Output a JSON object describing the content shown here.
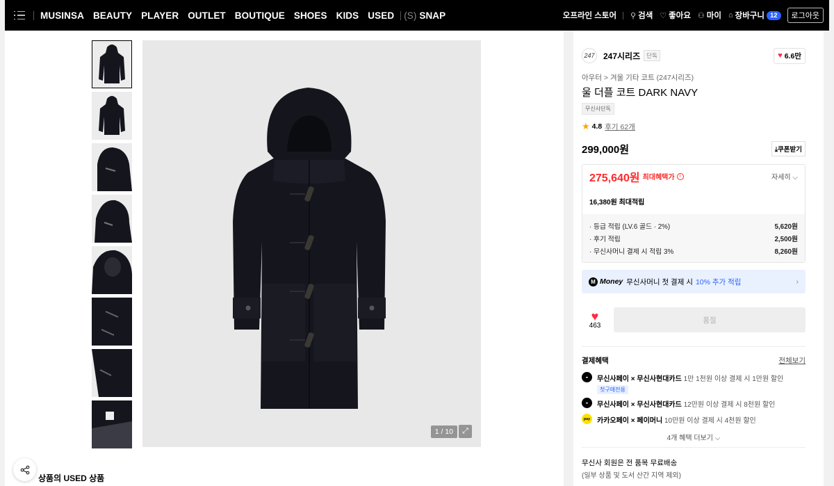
{
  "nav": {
    "items": [
      "MUSINSA",
      "BEAUTY",
      "PLAYER",
      "OUTLET",
      "BOUTIQUE",
      "SHOES",
      "KIDS",
      "USED"
    ],
    "snap_prefix": "(S)",
    "snap_label": "SNAP",
    "right": {
      "offline_store": "오프라인 스토어",
      "search": "검색",
      "like": "좋아요",
      "my": "마이",
      "cart": "장바구니",
      "cart_count": "12",
      "logout": "로그아웃"
    }
  },
  "gallery": {
    "counter": "1 / 10",
    "thumb_count": 8
  },
  "brand": {
    "logo_text": "247",
    "name": "247시리즈",
    "tag": "단독",
    "likes": "6.6만"
  },
  "product": {
    "breadcrumb": "아우터 > 겨울 기타 코트 (247시리즈)",
    "title": "울 더플 코트 DARK NAVY",
    "exclusive_tag": "무신사단독",
    "rating": "4.8",
    "reviews": "후기 62개",
    "original_price": "299,000원",
    "coupon_label": "쿠폰받기"
  },
  "benefit": {
    "sale_price": "275,640원",
    "max_benefit_label": "최대혜택가",
    "detail_label": "자세히",
    "points_title": "16,380원 최대적립",
    "list": [
      {
        "label": "· 등급 적립 (LV.6 골드 · 2%)",
        "value": "5,620원"
      },
      {
        "label": "· 후기 적립",
        "value": "2,500원"
      },
      {
        "label": "· 무신사머니 결제 시 적립 3%",
        "value": "8,260원"
      }
    ]
  },
  "money_banner": {
    "icon": "M",
    "word": "Money",
    "text": "무신사머니 첫 결제 시",
    "highlight": "10% 추가 적립"
  },
  "action": {
    "like_count": "463",
    "buy_label": "품절"
  },
  "payment": {
    "title": "결제혜택",
    "view_all": "전체보기",
    "items": [
      {
        "name": "무신사페이 × 무신사현대카드",
        "desc": "1만 1천원 이상 결제 시 1만원 할인",
        "tag": "첫구매전용"
      },
      {
        "name": "무신사페이 × 무신사현대카드",
        "desc": "12만원 이상 결제 시 8천원 할인"
      },
      {
        "name": "카카오페이 × 페이머니",
        "desc": "10만원 이상 결제 시 4천원 할인",
        "icon_text": "pay"
      }
    ],
    "more": "4개 혜택 더보기"
  },
  "shipping": {
    "title": "무신사 회원은 전 품목 무료배송",
    "sub": "(일부 상품 및 도서 산간 지역 제외)"
  },
  "bottom": {
    "used_title": "상품의 USED 상품"
  },
  "colors": {
    "accent_blue": "#2a63ff",
    "sale_red": "#ff2a2a",
    "heart_red": "#ff2a43",
    "coat_navy": "#15161d"
  }
}
